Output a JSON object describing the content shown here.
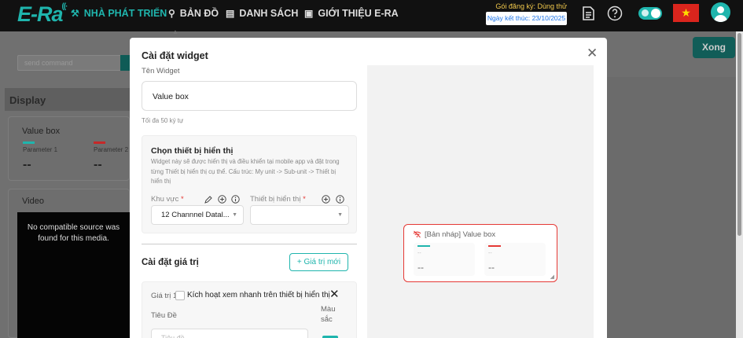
{
  "header": {
    "logo": "E-Ra",
    "nav": [
      {
        "label": "NHÀ PHÁT TRIỂN",
        "icon": "wrench-icon"
      },
      {
        "label": "BẢN ĐỒ",
        "icon": "map-pin-icon"
      },
      {
        "label": "DANH SÁCH",
        "icon": "list-icon"
      },
      {
        "label": "GIỚI THIỆU E-RA",
        "icon": "info-doc-icon"
      }
    ],
    "trial_label": "Gói đăng ký: Dùng thử",
    "expiry_label": "Ngày kết thúc: 23/10/2025",
    "flag_star": "★"
  },
  "background": {
    "send_command_placeholder": "send command",
    "display_heading": "Display",
    "valuebox_title": "Value box",
    "param1": "Parameter 1",
    "param2": "Parameter 2",
    "dash": "--",
    "video_title": "Video",
    "video_message": "No compatible source was found for this media.",
    "done_button": "Xong"
  },
  "modal": {
    "title": "Cài đặt widget",
    "name_label": "Tên Widget",
    "name_value": "Value box",
    "name_hint": "Tối đa 50 ký tự",
    "device_title": "Chọn thiết bị hiển thị",
    "device_desc": "Widget này sẽ được hiển thị và điều khiển tại mobile app và đặt trong từng Thiết bị hiển thị cụ thể. Cấu trúc: My unit -> Sub-unit -> Thiết bị hiển thị",
    "area_label": "Khu vực",
    "area_value": "12 Channnel Datal...",
    "display_device_label": "Thiết bị hiển thị",
    "display_device_value": "",
    "required_mark": "*",
    "value_settings_title": "Cài đặt giá trị",
    "add_value_button": "+ Giá trị mới",
    "value1_label": "Giá trị 1",
    "quick_view_label": "Kích hoạt xem nhanh trên thiết bị hiển thị",
    "title_field_label": "Tiêu Đề",
    "title_field_placeholder": "Tiêu đề",
    "color_label": "Màu sắc",
    "close_symbol": "✕"
  },
  "preview": {
    "title": "[Bản nháp] Value box",
    "cells": [
      {
        "sub": "--",
        "value": "--",
        "color": "#1fb5ad"
      },
      {
        "sub": "--",
        "value": "--",
        "color": "#e53935"
      }
    ]
  },
  "colors": {
    "accent": "#1fb5ad",
    "danger": "#e53935"
  }
}
